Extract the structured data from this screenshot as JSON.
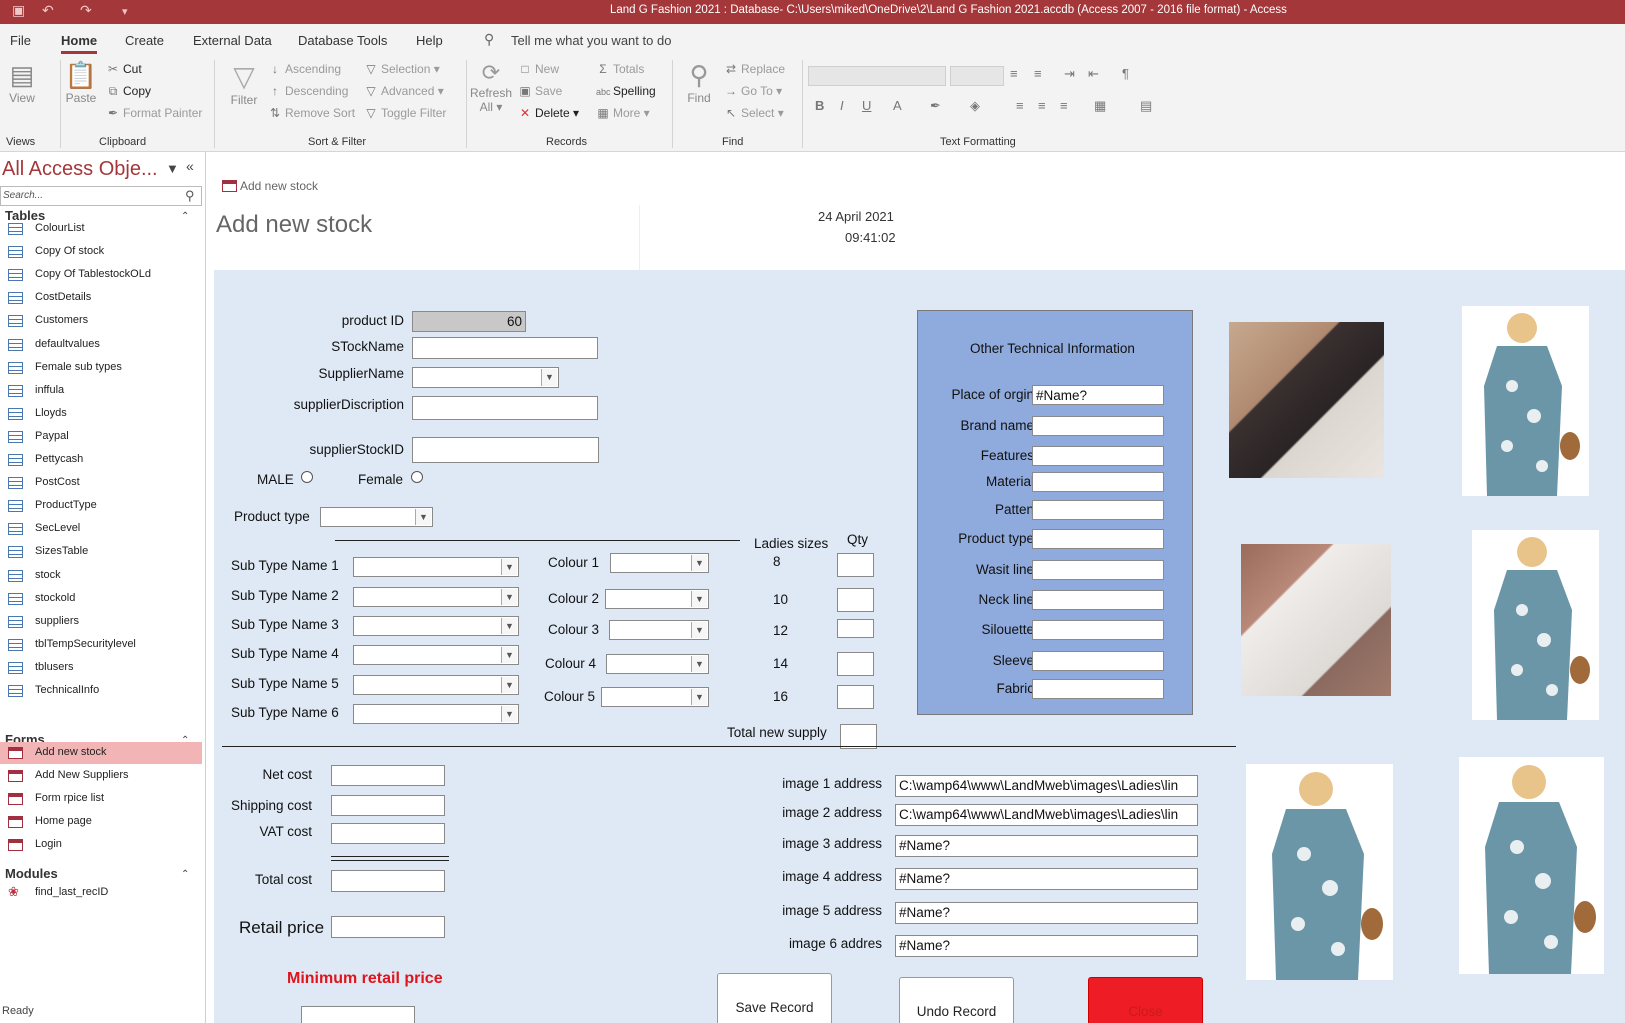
{
  "window": {
    "title": "Land G Fashion 2021 : Database- C:\\Users\\miked\\OneDrive\\2\\Land G Fashion 2021.accdb (Access 2007 - 2016 file format)  -  Access"
  },
  "menu": {
    "tabs": [
      "File",
      "Home",
      "Create",
      "External Data",
      "Database Tools",
      "Help"
    ],
    "active": "Home",
    "tell_me": "Tell me what you want to do"
  },
  "ribbon": {
    "views": {
      "view": "View",
      "group": "Views"
    },
    "clipboard": {
      "paste": "Paste",
      "cut": "Cut",
      "copy": "Copy",
      "format_painter": "Format Painter",
      "group": "Clipboard"
    },
    "sort_filter": {
      "filter": "Filter",
      "ascending": "Ascending",
      "descending": "Descending",
      "remove_sort": "Remove Sort",
      "selection": "Selection",
      "advanced": "Advanced",
      "toggle_filter": "Toggle Filter",
      "group": "Sort & Filter"
    },
    "records": {
      "refresh": "Refresh",
      "refresh_all": "All",
      "new": "New",
      "save": "Save",
      "delete": "Delete",
      "totals": "Totals",
      "spelling": "Spelling",
      "more": "More",
      "group": "Records"
    },
    "find": {
      "find": "Find",
      "replace": "Replace",
      "goto": "Go To",
      "select": "Select",
      "group": "Find"
    },
    "text_formatting": {
      "group": "Text Formatting"
    }
  },
  "nav": {
    "title": "All Access Obje...",
    "search_placeholder": "Search...",
    "sections": {
      "tables": "Tables",
      "forms": "Forms",
      "modules": "Modules"
    },
    "tables": [
      "ColourList",
      "Copy Of stock",
      "Copy Of TablestockOLd",
      "CostDetails",
      "Customers",
      "defaultvalues",
      "Female sub types",
      "inffula",
      "Lloyds",
      "Paypal",
      "Pettycash",
      "PostCost",
      "ProductType",
      "SecLevel",
      "SizesTable",
      "stock",
      "stockold",
      "suppliers",
      "tblTempSecuritylevel",
      "tblusers",
      "TechnicalInfo"
    ],
    "forms": [
      "Add new stock",
      "Add New Suppliers",
      "Form rpice list",
      "Home page",
      "Login"
    ],
    "selected_form": "Add new stock",
    "modules": [
      "find_last_recID"
    ]
  },
  "status": "Ready",
  "form": {
    "tab_label": "Add new stock",
    "title": "Add new stock",
    "date": "24 April 2021",
    "time": "09:41:02",
    "labels": {
      "product_id": "product ID",
      "stock_name": "STockName",
      "supplier_name": "SupplierName",
      "supplier_description": "supplierDiscription",
      "supplier_stock_id": "supplierStockID",
      "male": "MALE",
      "female": "Female",
      "product_type": "Product type",
      "ladies_sizes": "Ladies sizes",
      "qty": "Qty",
      "total_new_supply": "Total new supply",
      "net_cost": "Net cost",
      "shipping_cost": "Shipping  cost",
      "vat_cost": "VAT cost",
      "total_cost": "Total  cost",
      "retail_price": "Retail price",
      "min_retail_price": "Minimum retail price"
    },
    "product_id": "60",
    "sub_types": [
      "Sub Type Name 1",
      "Sub Type Name 2",
      "Sub Type Name 3",
      "Sub Type Name 4",
      "Sub Type Name 5",
      "Sub Type Name 6"
    ],
    "colours": [
      "Colour 1",
      "Colour 2",
      "Colour 3",
      "Colour 4",
      "Colour 5"
    ],
    "sizes": [
      "8",
      "10",
      "12",
      "14",
      "16"
    ],
    "technical": {
      "title": "Other Technical  Information",
      "fields": [
        {
          "label": "Place of orgin",
          "value": "#Name?"
        },
        {
          "label": "Brand name",
          "value": ""
        },
        {
          "label": "Features",
          "value": ""
        },
        {
          "label": "Material",
          "value": ""
        },
        {
          "label": "Patten",
          "value": ""
        },
        {
          "label": "Product type",
          "value": ""
        },
        {
          "label": "Wasit line",
          "value": ""
        },
        {
          "label": "Neck line",
          "value": ""
        },
        {
          "label": "Silouette",
          "value": ""
        },
        {
          "label": "Sleeve",
          "value": ""
        },
        {
          "label": "Fabric",
          "value": ""
        }
      ]
    },
    "images": [
      {
        "label": "image 1 address",
        "value": "C:\\wamp64\\www\\LandMweb\\images\\Ladies\\lin"
      },
      {
        "label": "image 2 address",
        "value": "C:\\wamp64\\www\\LandMweb\\images\\Ladies\\lin"
      },
      {
        "label": "image 3 address",
        "value": "#Name?"
      },
      {
        "label": "image 4 address",
        "value": "#Name?"
      },
      {
        "label": "image 5 address",
        "value": "#Name?"
      },
      {
        "label": "image 6 addres",
        "value": "#Name?"
      }
    ],
    "buttons": {
      "save": "Save Record",
      "undo": "Undo Record",
      "close": "Close"
    }
  },
  "colors": {
    "accent": "#a4373a",
    "form_bg": "#dfe9f5",
    "tech_box": "#8faadc",
    "close_button": "#ee1c25",
    "min_price_text": "#e0141c"
  }
}
